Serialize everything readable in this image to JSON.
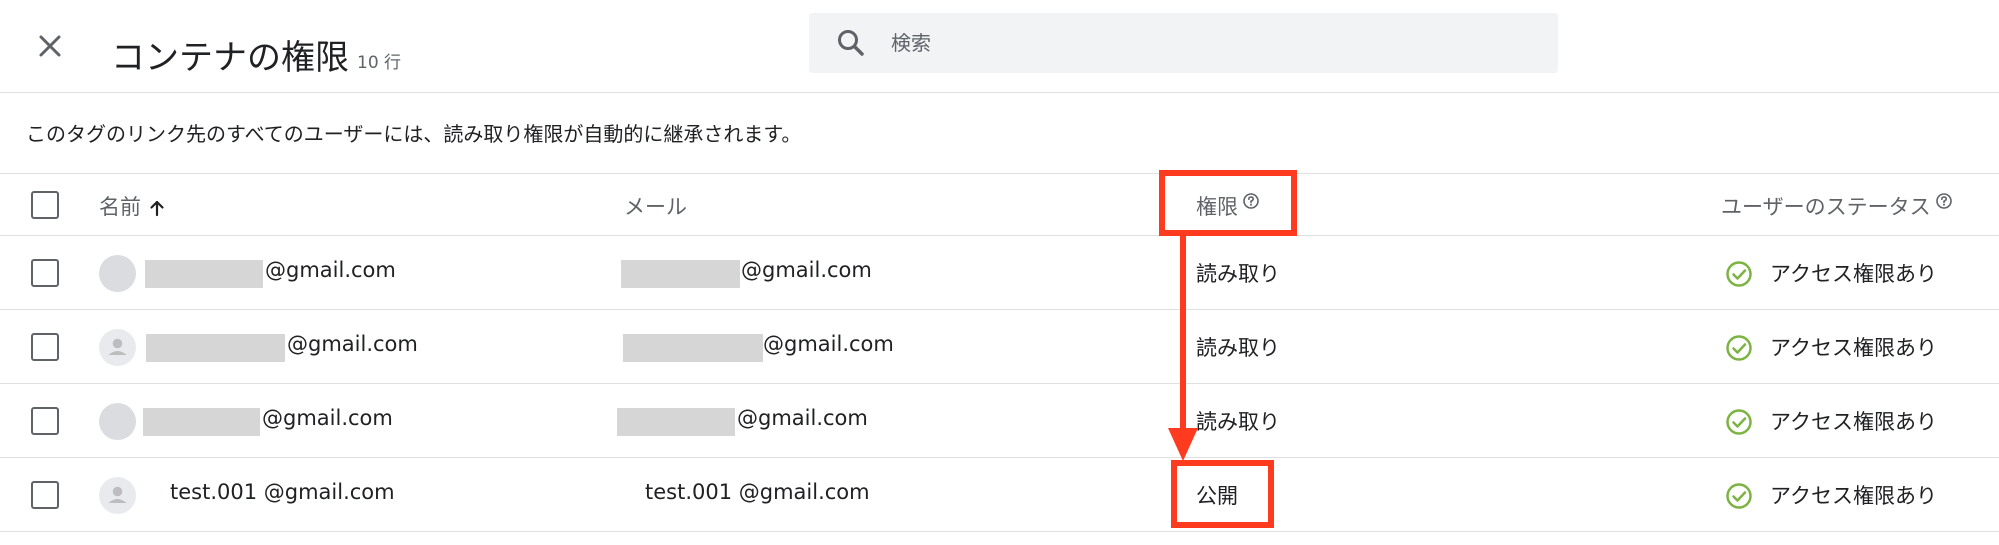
{
  "header": {
    "title": "コンテナの権限",
    "row_count": "10 行",
    "close_icon": "close-icon"
  },
  "search": {
    "placeholder": "検索",
    "icon": "search-icon"
  },
  "notice": "このタグのリンク先のすべてのユーザーには、読み取り権限が自動的に継承されます。",
  "table": {
    "columns": {
      "name": "名前",
      "email": "メール",
      "permission": "権限",
      "status": "ユーザーのステータス"
    },
    "rows": [
      {
        "name": "@gmail.com",
        "email": "@gmail.com",
        "permission": "読み取り",
        "status": "アクセス権限あり",
        "avatar": "gray-circle"
      },
      {
        "name": "@gmail.com",
        "email": "@gmail.com",
        "permission": "読み取り",
        "status": "アクセス権限あり",
        "avatar": "person-icon"
      },
      {
        "name": "@gmail.com",
        "email": "@gmail.com",
        "permission": "読み取り",
        "status": "アクセス権限あり",
        "avatar": "gray-circle"
      },
      {
        "name": "test.001 @gmail.com",
        "email": "test.001 @gmail.com",
        "permission": "公開",
        "status": "アクセス権限あり",
        "avatar": "person-icon"
      }
    ]
  },
  "colors": {
    "annotation": "#ff3b1f",
    "status_ok": "#7cb342",
    "secondary_text": "#5f6368"
  }
}
